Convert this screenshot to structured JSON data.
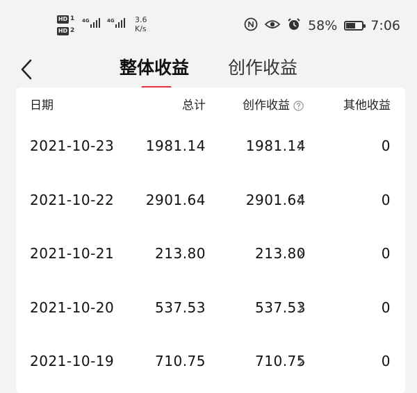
{
  "status_bar": {
    "hd_labels": [
      "HD",
      "HD"
    ],
    "sim_numbers": [
      "1",
      "2"
    ],
    "network": [
      "4G",
      "4G"
    ],
    "speed_value": "3.6",
    "speed_unit": "K/s",
    "battery_percent": "58%",
    "battery_level": 0.58,
    "time": "7:06",
    "icons": [
      "nfc-icon",
      "eye-comfort-icon",
      "alarm-icon",
      "battery-icon"
    ]
  },
  "header": {
    "back_icon": "chevron-left-icon",
    "tabs": [
      {
        "label": "整体收益",
        "active": true
      },
      {
        "label": "创作收益",
        "active": false
      }
    ],
    "accent_color": "#e5303d"
  },
  "table": {
    "columns": [
      "日期",
      "总计",
      "创作收益",
      "其他收益"
    ],
    "help_icon": "question-circle-icon",
    "rows": [
      {
        "date": "2021-10-23",
        "total": "1981.14",
        "creation": "1981.14",
        "other": "0"
      },
      {
        "date": "2021-10-22",
        "total": "2901.64",
        "creation": "2901.64",
        "other": "0"
      },
      {
        "date": "2021-10-21",
        "total": "213.80",
        "creation": "213.80",
        "other": "0"
      },
      {
        "date": "2021-10-20",
        "total": "537.53",
        "creation": "537.53",
        "other": "0"
      },
      {
        "date": "2021-10-19",
        "total": "710.75",
        "creation": "710.75",
        "other": "0"
      }
    ]
  }
}
